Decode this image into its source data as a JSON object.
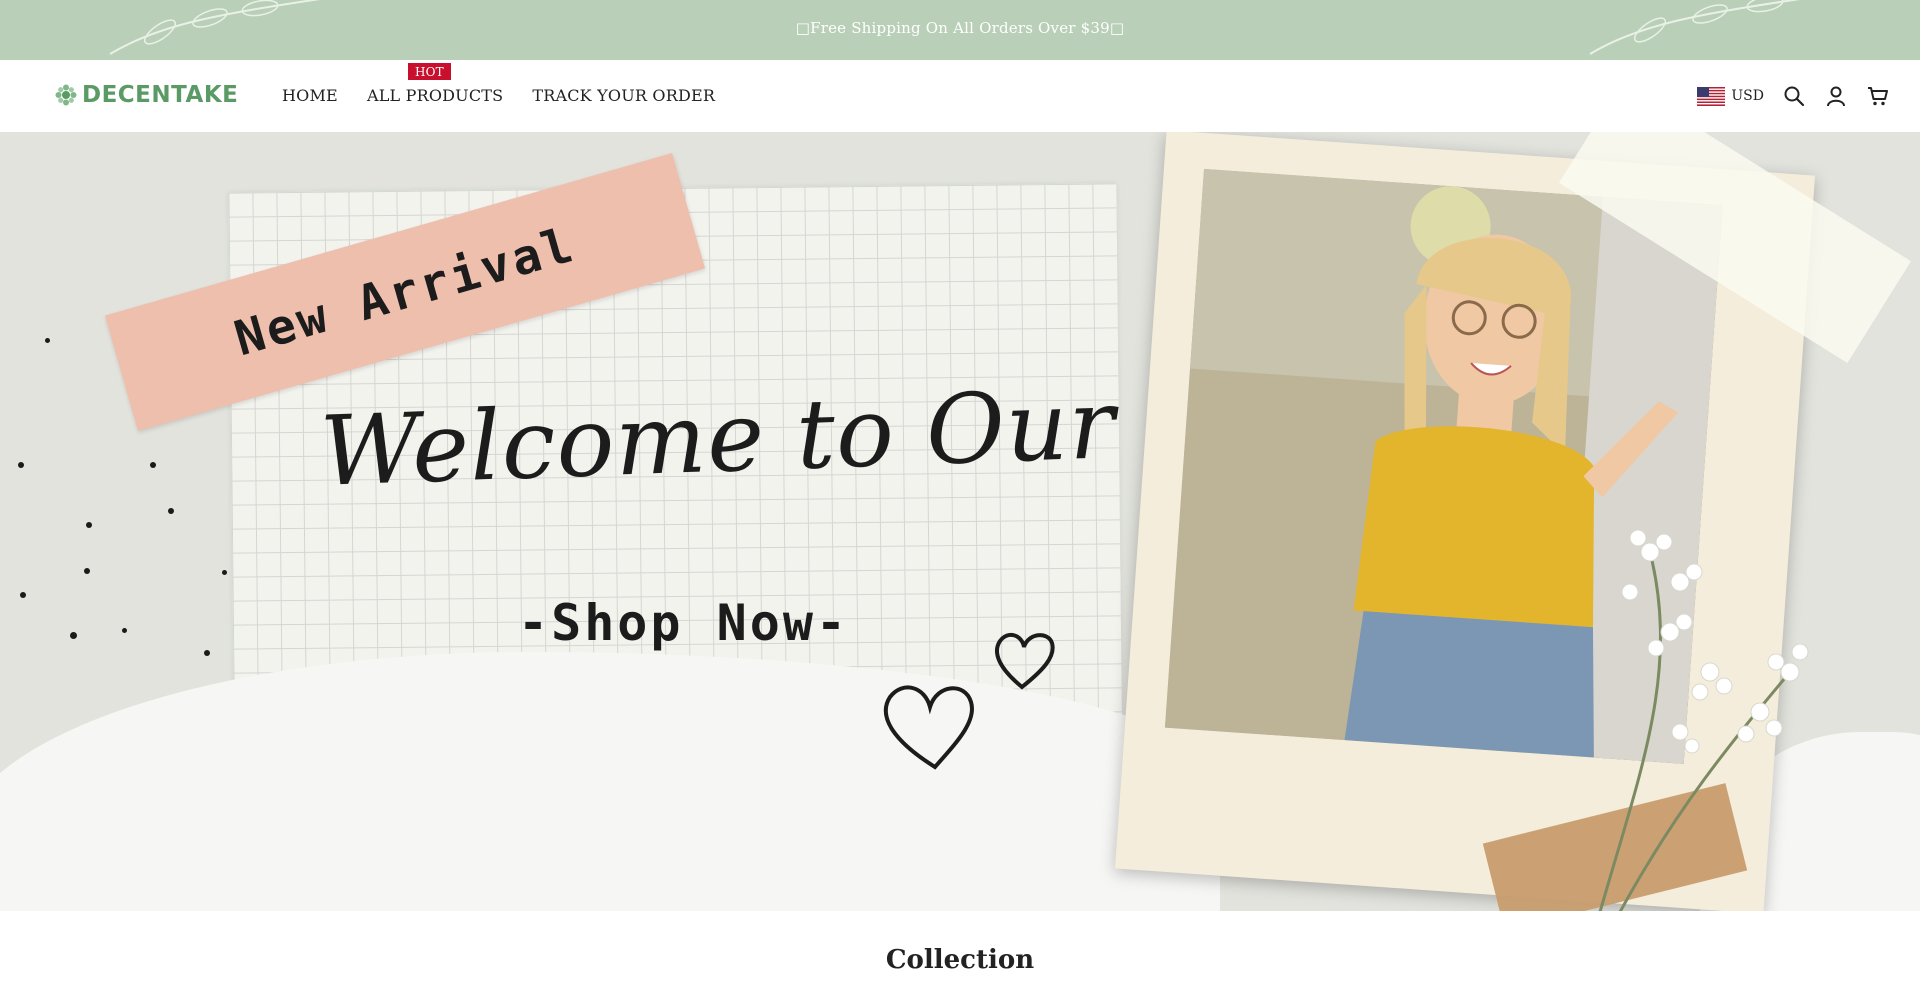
{
  "announcement": {
    "text": "□Free Shipping On All Orders Over $39□"
  },
  "header": {
    "logo": "DECENTAKE",
    "nav": [
      {
        "label": "HOME"
      },
      {
        "label": "ALL PRODUCTS",
        "badge": "HOT"
      },
      {
        "label": "TRACK YOUR ORDER"
      }
    ],
    "currency": "USD",
    "icons": [
      "flag-us-icon",
      "search-icon",
      "account-icon",
      "cart-icon"
    ]
  },
  "hero": {
    "tape_text": "New Arrival",
    "headline": "Welcome to Our Shop",
    "cta": "-Shop Now-"
  },
  "section": {
    "title": "Collection"
  },
  "colors": {
    "announcement_bg": "#b9cfb8",
    "logo_green": "#5a9a64",
    "hot_badge": "#c8102e",
    "hero_bg": "#e2e3dd",
    "tape_pink": "#efbfae"
  }
}
